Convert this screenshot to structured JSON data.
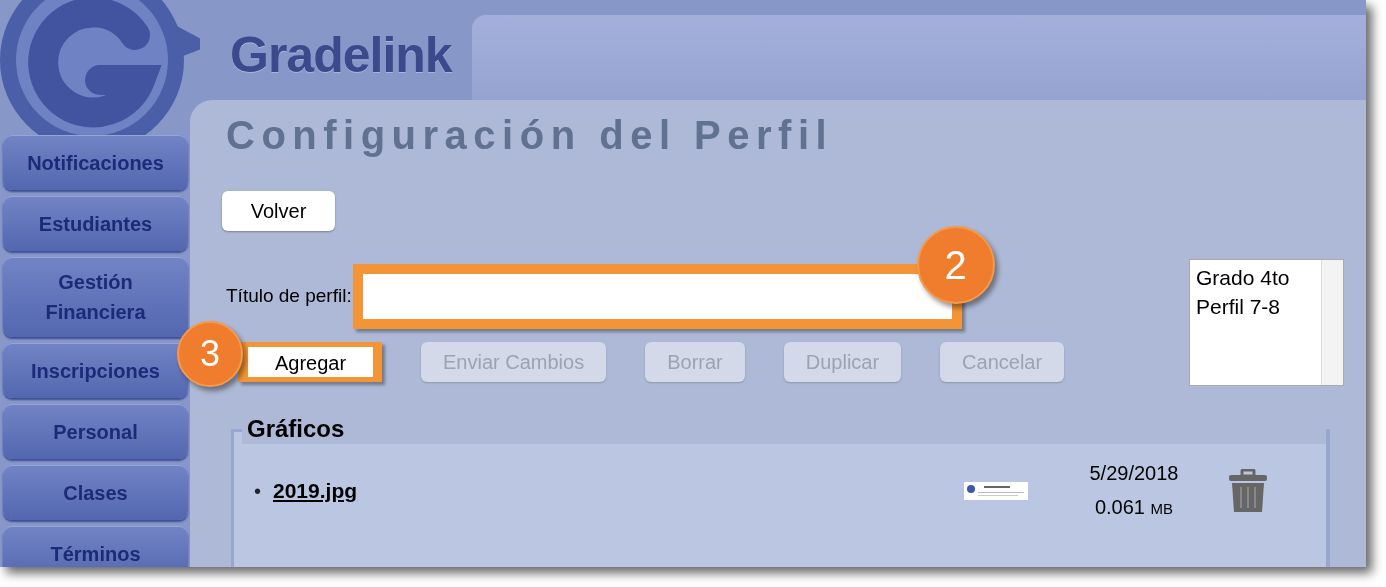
{
  "app": {
    "name": "Gradelink"
  },
  "sidebar": {
    "items": [
      {
        "label": "Notificaciones"
      },
      {
        "label": "Estudiantes"
      },
      {
        "label": "Gestión Financiera"
      },
      {
        "label": "Inscripciones"
      },
      {
        "label": "Personal"
      },
      {
        "label": "Clases"
      },
      {
        "label": "Términos"
      }
    ]
  },
  "page": {
    "title": "Configuración del Perfil",
    "back_button": "Volver"
  },
  "profile_form": {
    "title_label": "Título de perfil:",
    "title_field": {
      "callout": "2"
    }
  },
  "actions": [
    {
      "label": "Agregar",
      "disabled": false,
      "callout": "3"
    },
    {
      "label": "Enviar Cambios",
      "disabled": true
    },
    {
      "label": "Borrar",
      "disabled": true
    },
    {
      "label": "Duplicar",
      "disabled": true
    },
    {
      "label": "Cancelar",
      "disabled": true
    }
  ],
  "profiles_list": [
    {
      "label": "Grado 4to",
      "selected": false
    },
    {
      "label": "Perfil 7-8",
      "selected": false
    }
  ],
  "graphics": {
    "title": "Gráficos",
    "files": [
      {
        "bullet": "•",
        "name": "2019.jpg",
        "date": "5/29/2018",
        "size": "0.061",
        "unit": "MB"
      }
    ]
  }
}
